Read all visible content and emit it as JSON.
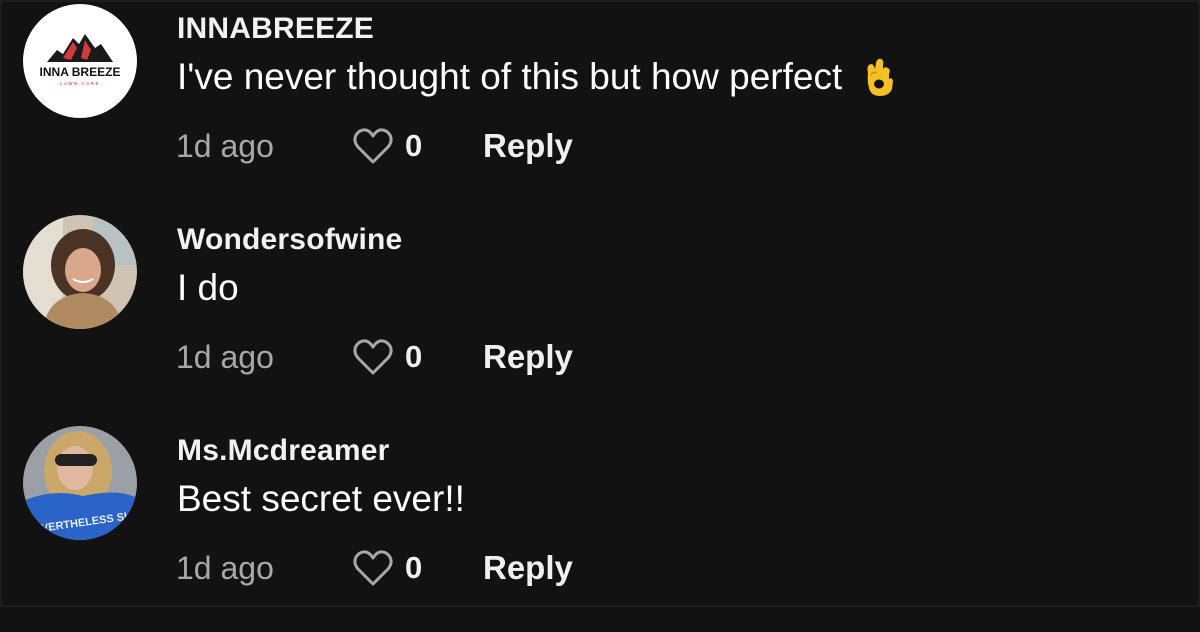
{
  "comments": [
    {
      "username": "INNABREEZE",
      "avatar": "inna-breeze-lawn-care-logo",
      "avatar_text": "INNA BREEZE",
      "avatar_subtext": "LAWN CARE",
      "text": "I've never thought of this but how perfect",
      "emoji": "ok-hand",
      "time": "1d ago",
      "likes": "0",
      "reply_label": "Reply"
    },
    {
      "username": "Wondersofwine",
      "avatar": "profile-photo-curly-hair-woman",
      "text": "I do",
      "time": "1d ago",
      "likes": "0",
      "reply_label": "Reply"
    },
    {
      "username": "Ms.Mcdreamer",
      "avatar": "profile-photo-woman-sunglasses-blue-shirt",
      "avatar_shirt_text": "NEVERTHELESS SHE",
      "text": "Best secret ever!!",
      "time": "1d ago",
      "likes": "0",
      "reply_label": "Reply"
    }
  ],
  "colors": {
    "background": "#121212",
    "username": "#f2f2f2",
    "secondary_text": "#a8a8a8",
    "emoji": "#f4c025"
  }
}
